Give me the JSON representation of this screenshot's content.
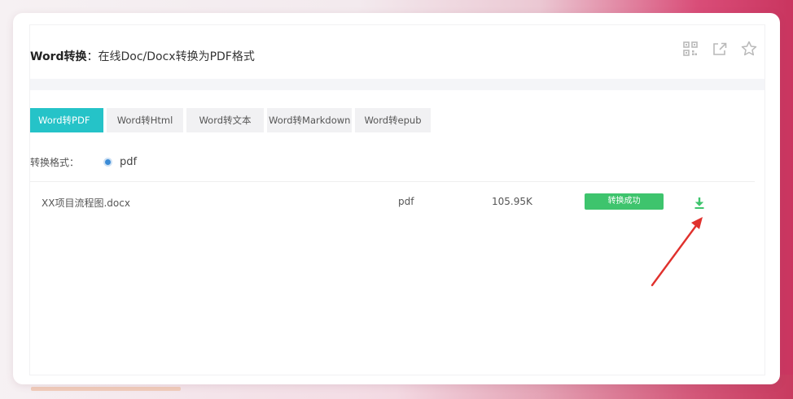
{
  "header": {
    "title_strong": "Word转换",
    "title_rest": "：在线Doc/Docx转换为PDF格式",
    "icons": [
      "qrcode-icon",
      "share-icon",
      "star-icon"
    ]
  },
  "tabs": [
    {
      "label": "Word转PDF",
      "active": true
    },
    {
      "label": "Word转Html",
      "active": false
    },
    {
      "label": "Word转文本",
      "active": false
    },
    {
      "label": "Word转Markdown",
      "active": false
    },
    {
      "label": "Word转epub",
      "active": false
    }
  ],
  "format": {
    "label": "转换格式：",
    "option": "pdf"
  },
  "files": [
    {
      "name": "XX项目流程图.docx",
      "type": "pdf",
      "size": "105.95K",
      "status": "转换成功",
      "action_icon": "download-icon"
    }
  ],
  "colors": {
    "accent": "#25c3c8",
    "success": "#3ec46d",
    "annotation_arrow": "#e0312d"
  }
}
